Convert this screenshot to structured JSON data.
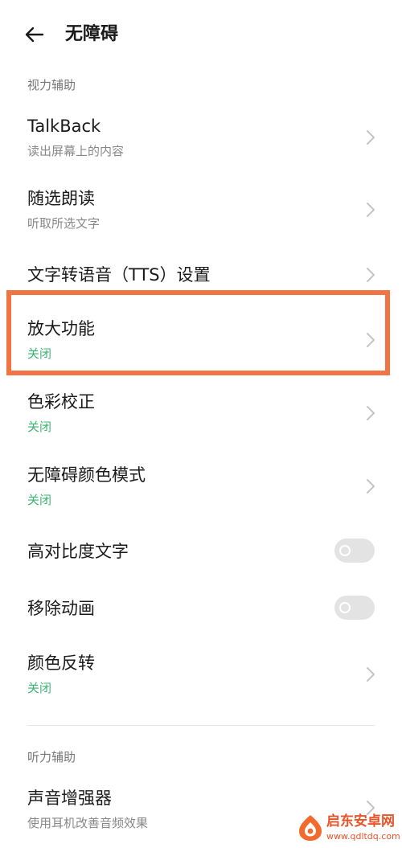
{
  "header": {
    "title": "无障碍"
  },
  "sections": {
    "vision": "视力辅助",
    "hearing": "听力辅助"
  },
  "rows": {
    "talkback": {
      "title": "TalkBack",
      "subtitle": "读出屏幕上的内容"
    },
    "select_to_speak": {
      "title": "随选朗读",
      "subtitle": "听取所选文字"
    },
    "tts": {
      "title": "文字转语音（TTS）设置"
    },
    "magnification": {
      "title": "放大功能",
      "status": "关闭"
    },
    "color_correction": {
      "title": "色彩校正",
      "status": "关闭"
    },
    "accessibility_color_mode": {
      "title": "无障碍颜色模式",
      "status": "关闭"
    },
    "high_contrast_text": {
      "title": "高对比度文字",
      "toggle": "off"
    },
    "remove_animations": {
      "title": "移除动画",
      "toggle": "off"
    },
    "color_inversion": {
      "title": "颜色反转",
      "status": "关闭"
    },
    "sound_amplifier": {
      "title": "声音增强器",
      "subtitle": "使用耳机改善音频效果"
    }
  },
  "watermark": {
    "name": "启东安卓网",
    "url": "www.qdltdq.com"
  },
  "colors": {
    "status_green": "#3cb371",
    "highlight": "#f07444"
  }
}
